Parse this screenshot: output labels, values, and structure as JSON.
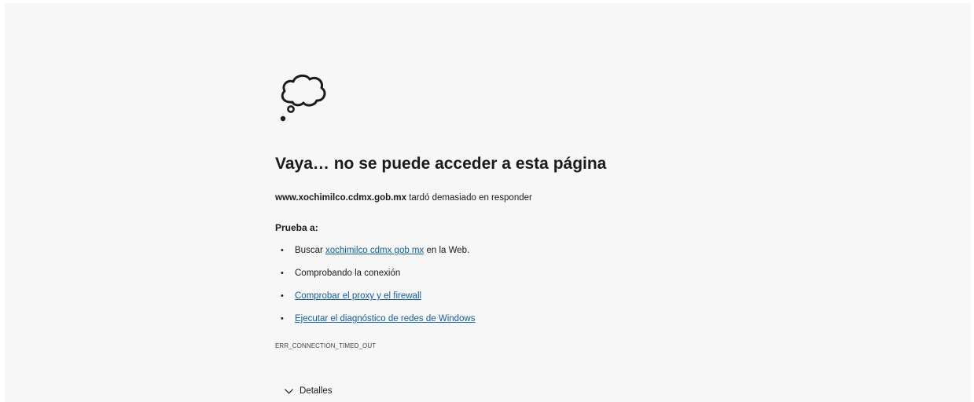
{
  "error_page": {
    "icon": "thought-cloud-icon",
    "title": "Vaya… no se puede acceder a esta página",
    "host": "www.xochimilco.cdmx.gob.mx",
    "host_message": "tardó demasiado en responder",
    "try_label": "Prueba a:",
    "suggestions": {
      "search_prefix": "Buscar",
      "search_link": "xochimilco cdmx gob mx",
      "search_suffix": "en la Web.",
      "check_connection": "Comprobando la conexión",
      "proxy_link": "Comprobar el proxy y el firewall",
      "diagnostics_link": "Ejecutar el diagnóstico de redes de Windows"
    },
    "error_code": "ERR_CONNECTION_TIMED_OUT",
    "details_label": "Detalles",
    "details_icon": "chevron-down-icon"
  },
  "colors": {
    "background": "#f7f7f7",
    "link": "#0e5fa8",
    "text": "#1b1b1b"
  }
}
